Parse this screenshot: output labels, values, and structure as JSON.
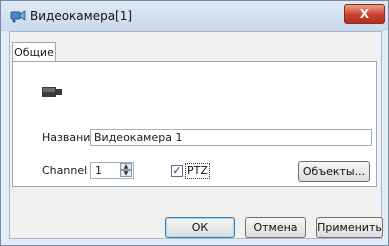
{
  "window": {
    "title": "Видеокамера[1]",
    "close_label": "X"
  },
  "tabs": [
    {
      "label": "Общие",
      "selected": true
    }
  ],
  "form": {
    "name_label": "Название",
    "name_value": "Видеокамера 1",
    "channel_label": "Channel",
    "channel_value": "1",
    "ptz_label": "PTZ",
    "ptz_checked": true,
    "objects_button": "Объекты..."
  },
  "footer": {
    "ok_button": "ОК",
    "cancel_button": "Отмена",
    "apply_button": "Применить"
  },
  "icons": {
    "title_icon": "camera-icon",
    "device_icon": "camera-icon"
  },
  "colors": {
    "close_button": "#c8412c",
    "titlebar": "#dfe9f5"
  }
}
